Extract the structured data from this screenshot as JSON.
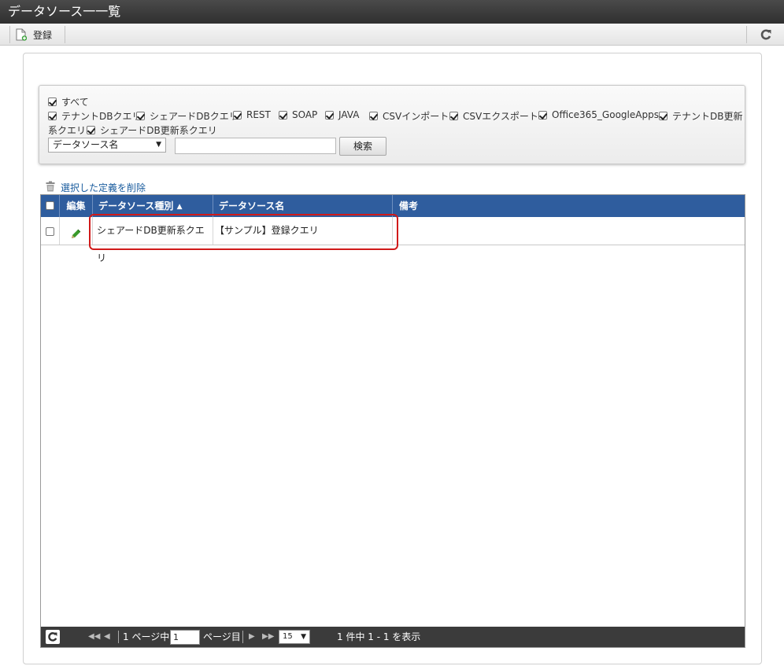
{
  "window": {
    "title": "データソース一一覧"
  },
  "toolbar": {
    "register_label": "登録"
  },
  "filters": {
    "all_label": "すべて",
    "types": [
      "テナントDBクエリ",
      "シェアードDBクエリ",
      "REST",
      "SOAP",
      "JAVA",
      "CSVインポート",
      "CSVエクスポート",
      "Office365_GoogleApps",
      "テナントDB更新系クエリ",
      "シェアードDB更新系クエリ"
    ],
    "type_line1_last": "テナントDB更新",
    "type_line2_first": "系クエリ",
    "search_field": "データソース名",
    "search_value": "",
    "search_button": "検索"
  },
  "actions": {
    "delete_selected": "選択した定義を削除"
  },
  "grid": {
    "columns": {
      "edit": "編集",
      "type": "データソース種別",
      "name": "データソース名",
      "note": "備考"
    },
    "rows": [
      {
        "type": "シェアードDB更新系クエリ",
        "name": "【サンプル】登録クエリ",
        "note": ""
      }
    ]
  },
  "pager": {
    "page_prefix": "1 ページ中",
    "current_page": "1",
    "page_suffix": "ページ目",
    "per_page": "15",
    "summary": "1 件中 1 - 1 を表示"
  },
  "colors": {
    "header_blue": "#2f5d9e",
    "highlight_red": "#d01a1a",
    "pager_dark": "#3b3b3b"
  }
}
